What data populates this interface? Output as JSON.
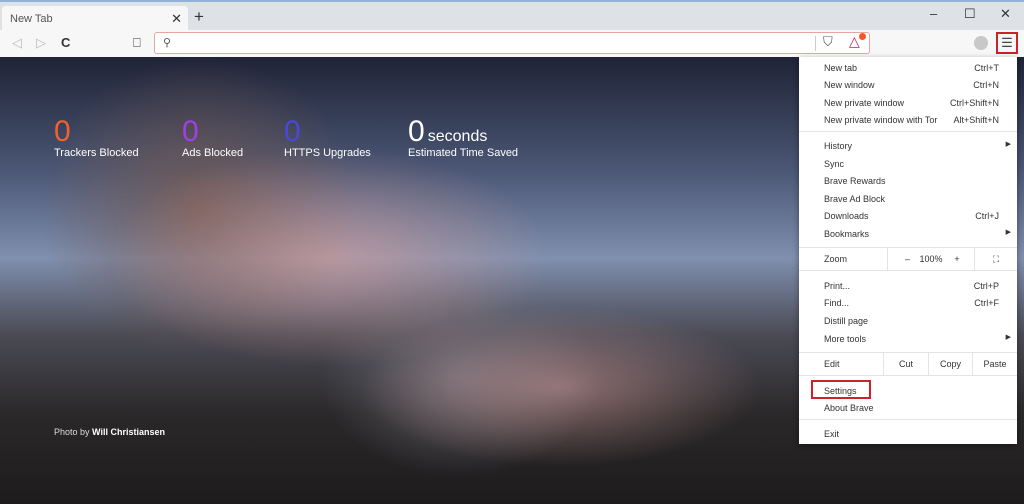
{
  "tab": {
    "title": "New Tab"
  },
  "window": {
    "minimize": "–",
    "maximize": "☐",
    "close": "✕"
  },
  "toolbar": {
    "back": "◁",
    "forward": "▷",
    "reload": "C",
    "bookmark": "⎕",
    "search_placeholder": ""
  },
  "stats": [
    {
      "value": "0",
      "label": "Trackers Blocked",
      "color": "#f06030"
    },
    {
      "value": "0",
      "label": "Ads Blocked",
      "color": "#a040e0"
    },
    {
      "value": "0",
      "label": "HTTPS Upgrades",
      "color": "#4a48d8"
    },
    {
      "value": "0",
      "unit": "seconds",
      "label": "Estimated Time Saved",
      "color": "#ffffff"
    }
  ],
  "credit": {
    "prefix": "Photo by",
    "author": "Will Christiansen"
  },
  "menu": {
    "group1": [
      {
        "label": "New tab",
        "shortcut": "Ctrl+T"
      },
      {
        "label": "New window",
        "shortcut": "Ctrl+N"
      },
      {
        "label": "New private window",
        "shortcut": "Ctrl+Shift+N"
      },
      {
        "label": "New private window with Tor",
        "shortcut": "Alt+Shift+N"
      }
    ],
    "group2": [
      {
        "label": "History",
        "shortcut": ""
      },
      {
        "label": "Sync",
        "shortcut": ""
      },
      {
        "label": "Brave Rewards",
        "shortcut": ""
      },
      {
        "label": "Brave Ad Block",
        "shortcut": ""
      },
      {
        "label": "Downloads",
        "shortcut": "Ctrl+J"
      },
      {
        "label": "Bookmarks",
        "shortcut": ""
      }
    ],
    "zoom": {
      "label": "Zoom",
      "minus": "–",
      "value": "100%",
      "plus": "+",
      "fullscreen": "⛶"
    },
    "group3": [
      {
        "label": "Print...",
        "shortcut": "Ctrl+P"
      },
      {
        "label": "Find...",
        "shortcut": "Ctrl+F"
      },
      {
        "label": "Distill page",
        "shortcut": ""
      },
      {
        "label": "More tools",
        "shortcut": ""
      }
    ],
    "edit": {
      "label": "Edit",
      "cut": "Cut",
      "copy": "Copy",
      "paste": "Paste"
    },
    "settings": "Settings",
    "about": "About Brave",
    "exit": "Exit"
  }
}
